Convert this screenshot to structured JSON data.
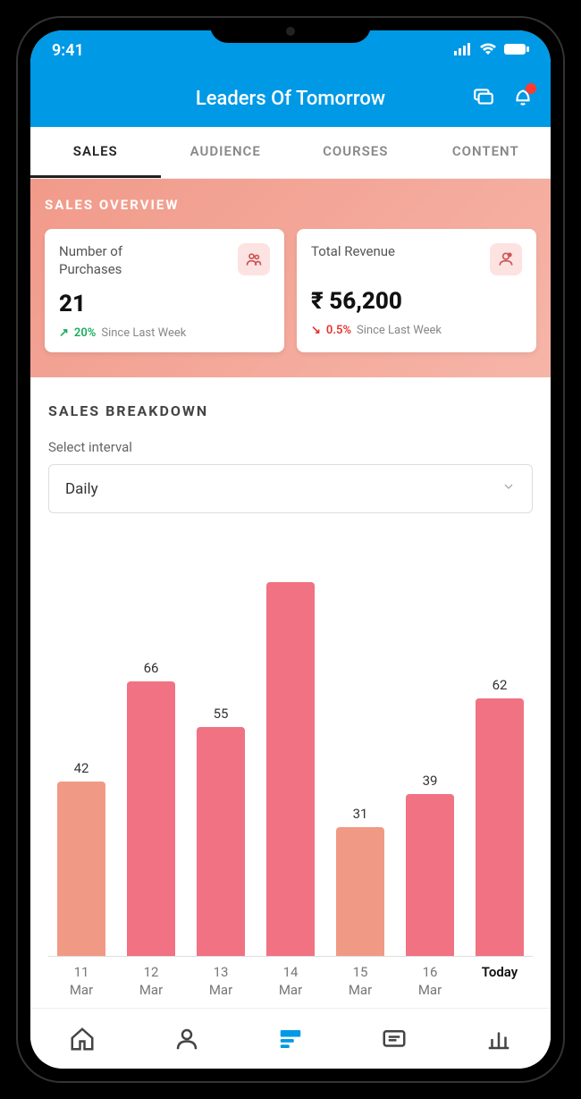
{
  "status": {
    "time": "9:41"
  },
  "header": {
    "title": "Leaders Of Tomorrow"
  },
  "tabs": [
    {
      "label": "SALES",
      "active": true
    },
    {
      "label": "AUDIENCE",
      "active": false
    },
    {
      "label": "COURSES",
      "active": false
    },
    {
      "label": "CONTENT",
      "active": false
    }
  ],
  "overview": {
    "title": "SALES OVERVIEW",
    "cards": [
      {
        "label": "Number of Purchases",
        "value": "21",
        "trend_dir": "up",
        "trend_pct": "20%",
        "trend_since": "Since Last Week"
      },
      {
        "label": "Total Revenue",
        "value": "₹ 56,200",
        "trend_dir": "down",
        "trend_pct": "0.5%",
        "trend_since": "Since Last Week"
      }
    ]
  },
  "breakdown": {
    "title": "SALES BREAKDOWN",
    "select_label": "Select interval",
    "select_value": "Daily"
  },
  "chart_data": {
    "type": "bar",
    "categories": [
      "11 Mar",
      "12 Mar",
      "13 Mar",
      "14 Mar",
      "15 Mar",
      "16 Mar",
      "Today"
    ],
    "values": [
      42,
      66,
      55,
      90,
      31,
      39,
      62
    ],
    "bar_labels": [
      "42",
      "66",
      "55",
      "",
      "31",
      "39",
      "62"
    ],
    "colors": [
      "#f09a85",
      "#f07283",
      "#f07283",
      "#f07283",
      "#f09a85",
      "#f07283",
      "#f07283"
    ],
    "title": "",
    "xlabel": "",
    "ylabel": "",
    "ylim": [
      0,
      100
    ]
  }
}
